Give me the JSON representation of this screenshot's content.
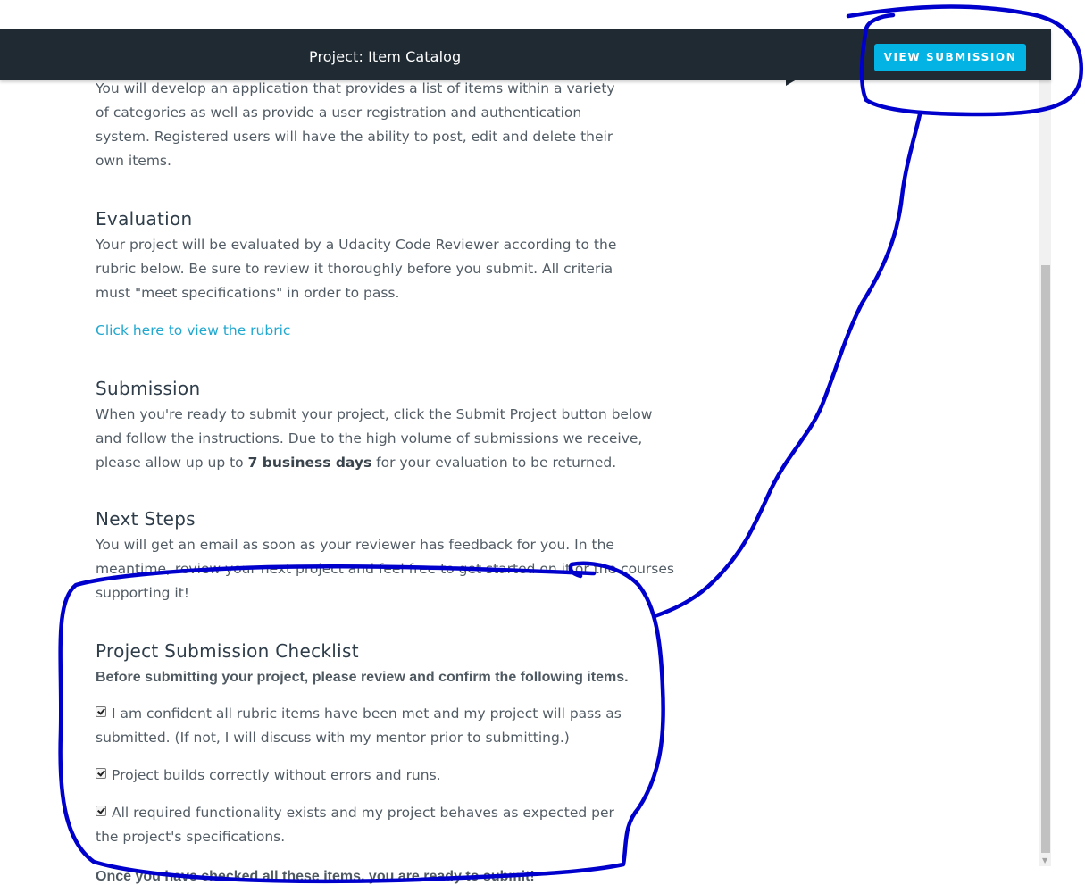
{
  "header": {
    "project_title": "Project: Item Catalog",
    "view_submission_label": "VIEW SUBMISSION"
  },
  "intro": {
    "text": "You will develop an application that provides a list of items within a variety of categories as well as provide a user registration and authentication system. Registered users will have the ability to post, edit and delete their own items."
  },
  "evaluation": {
    "title": "Evaluation",
    "text": "Your project will be evaluated by a Udacity Code Reviewer according to the rubric below. Be sure to review it thoroughly before you submit. All criteria must \"meet specifications\" in order to pass.",
    "rubric_link": "Click here to view the rubric"
  },
  "submission": {
    "title": "Submission",
    "text_before": "When you're ready to submit your project, click the Submit Project button below and follow the instructions. Due to the high volume of submissions we receive, please allow up up to ",
    "text_bold": "7 business days",
    "text_after": " for your evaluation to be returned."
  },
  "next_steps": {
    "title": "Next Steps",
    "text": "You will get an email as soon as your reviewer has feedback for you. In the meantime, review your next project and feel free to get started on it or the courses supporting it!"
  },
  "checklist": {
    "title": "Project Submission Checklist",
    "intro": "Before submitting your project, please review and confirm the following items.",
    "items": [
      {
        "label": "I am confident all rubric items have been met and my project will pass as submitted. (If not, I will discuss with my mentor prior to submitting.)",
        "checked": true
      },
      {
        "label": "Project builds correctly without errors and runs.",
        "checked": true
      },
      {
        "label": "All required functionality exists and my project behaves as expected per the project's specifications.",
        "checked": true
      }
    ],
    "outro": "Once you have checked all these items, you are ready to submit!"
  },
  "colors": {
    "topbar": "#1f2a33",
    "accent_button": "#02b3e4",
    "link": "#20a8cf",
    "annotation_ink": "#0000cc"
  }
}
